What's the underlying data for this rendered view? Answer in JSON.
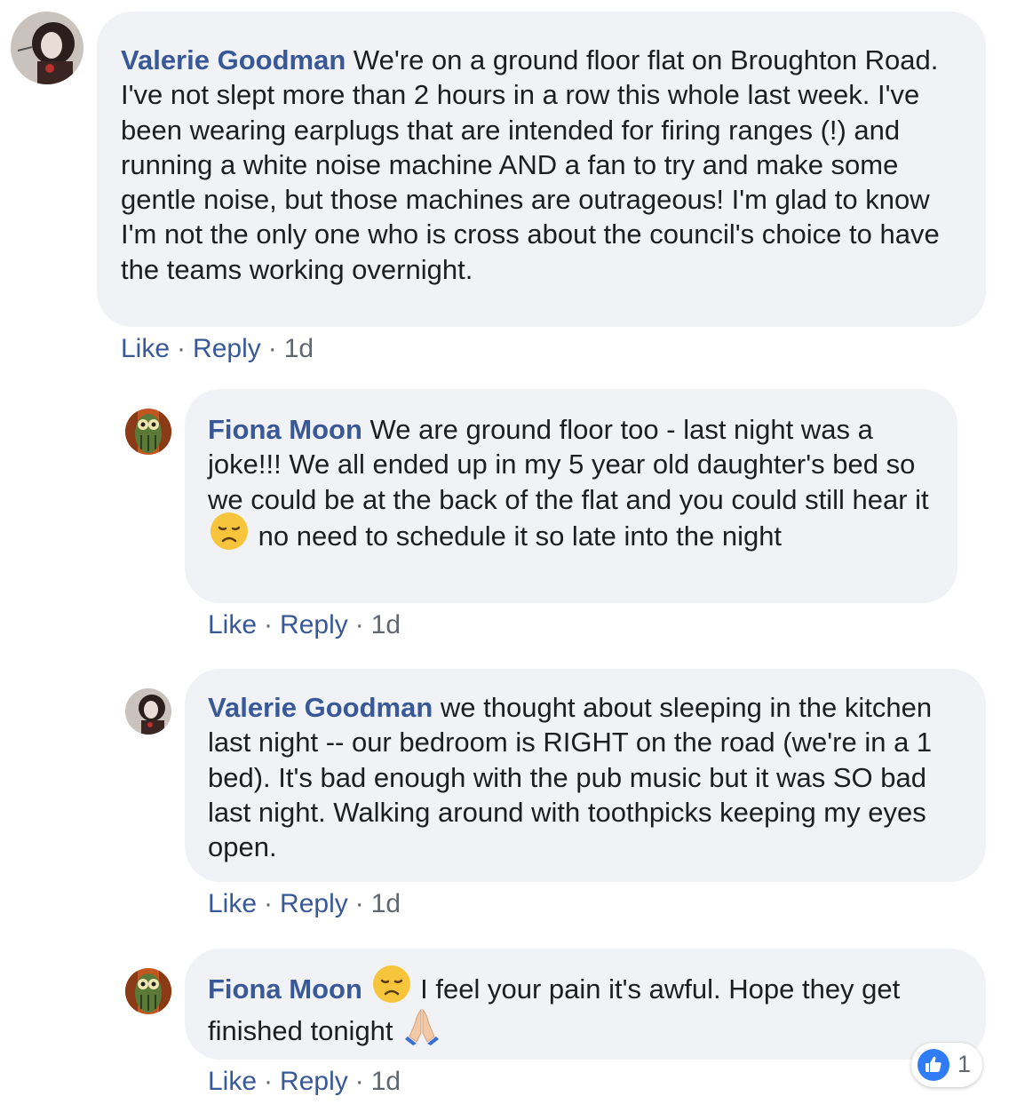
{
  "comments": [
    {
      "author": "Valerie Goodman",
      "text": "We're on a ground floor flat on Broughton Road. I've not slept more than 2 hours in a row this whole last week. I've been wearing earplugs that are intended for firing ranges (!) and running a white noise machine AND a fan to try and make some gentle noise, but those machines are outrageous! I'm glad to know I'm not the only one who is cross about the council's choice to have the teams working overnight.",
      "like_label": "Like",
      "reply_label": "Reply",
      "time": "1d"
    },
    {
      "author": "Fiona Moon",
      "text_before": "We are ground floor too - last night was a joke!!! We all ended up in my 5 year old daughter's bed so we could be at the back of the flat and you could still hear it",
      "emoji": "disappointed-face",
      "text_after": "no need to schedule it so late into the night",
      "like_label": "Like",
      "reply_label": "Reply",
      "time": "1d"
    },
    {
      "author": "Valerie Goodman",
      "text": "we thought about sleeping in the kitchen last night -- our bedroom is RIGHT on the road (we're in a 1 bed). It's bad enough with the pub music but it was SO bad last night. Walking around with toothpicks keeping my eyes open.",
      "like_label": "Like",
      "reply_label": "Reply",
      "time": "1d"
    },
    {
      "author": "Fiona Moon",
      "emoji": "disappointed-face",
      "text_before": "I feel your pain it's awful. Hope they get finished tonight",
      "emoji_end": "folded-hands",
      "like_label": "Like",
      "reply_label": "Reply",
      "time": "1d",
      "reaction_icon": "thumbs-up-icon",
      "reaction_count": "1"
    }
  ],
  "colors": {
    "author": "#385898",
    "bubble": "#f1f2f5",
    "meta": "#606770",
    "like_blue": "#2f7cf6"
  }
}
